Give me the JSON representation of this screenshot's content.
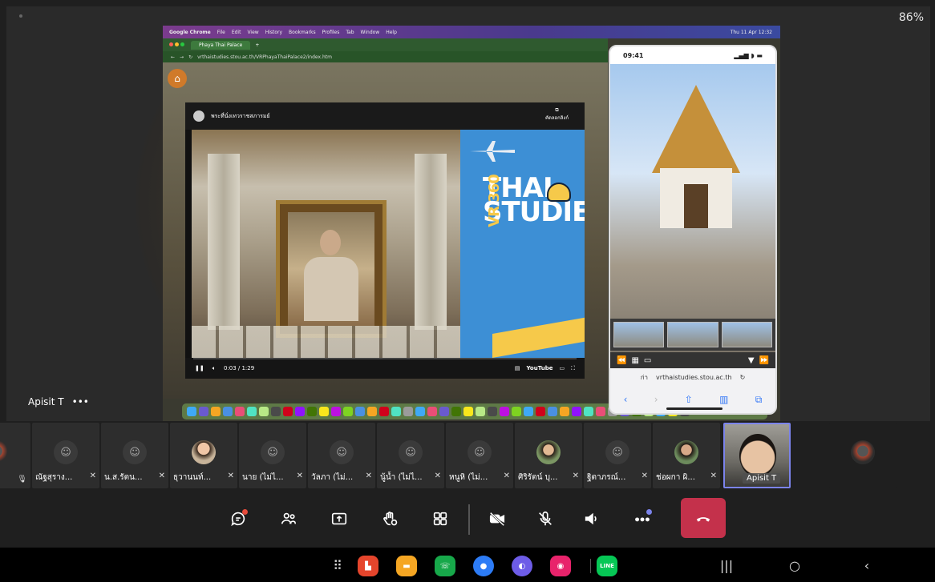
{
  "status": {
    "battery": "86%"
  },
  "presenter": {
    "name": "Apisit T",
    "more": "•••"
  },
  "mac": {
    "menubar": [
      "Google Chrome",
      "File",
      "Edit",
      "View",
      "History",
      "Bookmarks",
      "Profiles",
      "Tab",
      "Window",
      "Help"
    ],
    "clock": "Thu 11 Apr 12:32",
    "tab_title": "Phaya Thai Palace",
    "url": "vrthaistudies.stou.ac.th/VRPhayaThaiPalace2/index.htm"
  },
  "player": {
    "title": "พระที่นั่งเทวราชสภารมย์",
    "share_label": "คัดลอกลิงก์",
    "time": "0:03 / 1:29",
    "brand_line1": "THAI",
    "brand_line2": "STUDIES",
    "brand_vr": "VR 360",
    "youtube": "YouTube"
  },
  "phone": {
    "time": "09:41",
    "url": "vrthaistudies.stou.ac.th",
    "aa": "ก่า"
  },
  "participants": [
    {
      "name": "ณัฐสุราง...",
      "type": "generic"
    },
    {
      "name": "น.ส.รัตน...",
      "type": "generic"
    },
    {
      "name": "ธุวานนท์...",
      "type": "photo"
    },
    {
      "name": "นาย (ไม่ไ...",
      "type": "generic"
    },
    {
      "name": "วัลภา (ไม่...",
      "type": "generic"
    },
    {
      "name": "นู้น้ำ (ไม่ไ...",
      "type": "generic"
    },
    {
      "name": "หนูหิ (ไม่...",
      "type": "generic"
    },
    {
      "name": "ศิริรัตน์ บุ...",
      "type": "photo2"
    },
    {
      "name": "ฐิตาภรณ์...",
      "type": "generic"
    },
    {
      "name": "ช่อผกา ผิ...",
      "type": "photo3"
    }
  ],
  "active_participant": {
    "name": "Apisit T"
  },
  "controls": {
    "chat": "chat",
    "people": "people",
    "share": "share",
    "raise": "raise-hand",
    "apps": "apps",
    "camera": "camera-off",
    "mic": "mic-off",
    "speaker": "speaker",
    "more": "more",
    "leave": "leave"
  },
  "nav_apps": [
    "apps-grid",
    "office",
    "files",
    "phone",
    "messages",
    "browser",
    "camera",
    "line"
  ],
  "nav_line_label": "LINE",
  "colors": {
    "leave": "#c4314b",
    "accent": "#7b83eb",
    "badge": "#e74c3c"
  }
}
